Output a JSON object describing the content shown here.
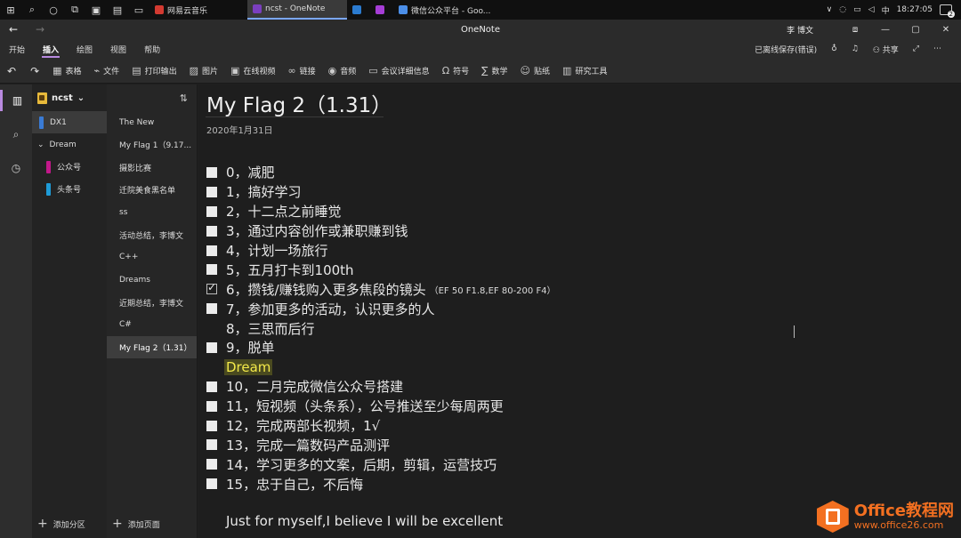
{
  "taskbar": {
    "apps": [
      {
        "label": "网易云音乐",
        "color": "#d33a31",
        "active": false
      },
      {
        "label": "ncst - OneNote",
        "color": "#7b3fbf",
        "active": true
      },
      {
        "label": "",
        "color": "#2b7bd0",
        "active": false
      },
      {
        "label": "",
        "color": "#a63dd6",
        "active": false
      },
      {
        "label": "微信公众平台 - Goo...",
        "color": "#4b8ee8",
        "active": false
      }
    ],
    "tray": {
      "ime": "中",
      "time": "18:27:05",
      "notifications": "2"
    }
  },
  "titlebar": {
    "title": "OneNote",
    "user": "李 博文"
  },
  "ribbon": {
    "tabs": [
      "开始",
      "插入",
      "绘图",
      "视图",
      "帮助"
    ],
    "active_tab": "插入",
    "save_status": "已离线保存(错误)",
    "share": "共享"
  },
  "toolbar": {
    "items": [
      {
        "label": "表格",
        "icon": "table-icon",
        "glyph": "▦"
      },
      {
        "label": "文件",
        "icon": "attach-icon",
        "glyph": "⌁"
      },
      {
        "label": "打印输出",
        "icon": "printout-icon",
        "glyph": "▤"
      },
      {
        "label": "图片",
        "icon": "picture-icon",
        "glyph": "▨"
      },
      {
        "label": "在线视频",
        "icon": "video-icon",
        "glyph": "▣"
      },
      {
        "label": "链接",
        "icon": "link-icon",
        "glyph": "∞"
      },
      {
        "label": "音频",
        "icon": "audio-icon",
        "glyph": "◉"
      },
      {
        "label": "会议详细信息",
        "icon": "meeting-icon",
        "glyph": "▭"
      },
      {
        "label": "符号",
        "icon": "omega-icon",
        "glyph": "Ω"
      },
      {
        "label": "数学",
        "icon": "math-icon",
        "glyph": "∑"
      },
      {
        "label": "贴纸",
        "icon": "sticker-icon",
        "glyph": "☺"
      },
      {
        "label": "研究工具",
        "icon": "research-icon",
        "glyph": "▥"
      }
    ]
  },
  "sections": {
    "notebook": "ncst",
    "items": [
      {
        "label": "DX1",
        "color": "#3a7bd5",
        "kind": "section",
        "selected": true
      },
      {
        "label": "Dream",
        "color": "",
        "kind": "group",
        "selected": false
      },
      {
        "label": "公众号",
        "color": "#c2188a",
        "kind": "child",
        "selected": false
      },
      {
        "label": "头条号",
        "color": "#1e9bd7",
        "kind": "child",
        "selected": false
      }
    ],
    "add_label": "添加分区"
  },
  "pages": {
    "items": [
      {
        "label": "The New",
        "selected": false
      },
      {
        "label": "My Flag 1（9.17...",
        "selected": false
      },
      {
        "label": "摄影比赛",
        "selected": false
      },
      {
        "label": "迁院美食黑名单",
        "selected": false
      },
      {
        "label": "ss",
        "selected": false
      },
      {
        "label": "活动总结，李博文",
        "selected": false
      },
      {
        "label": "C++",
        "selected": false
      },
      {
        "label": "Dreams",
        "selected": false
      },
      {
        "label": "近期总结，李博文",
        "selected": false
      },
      {
        "label": "C#",
        "selected": false
      },
      {
        "label": "My Flag 2（1.31）",
        "selected": true
      }
    ],
    "add_label": "添加页面"
  },
  "note": {
    "title": "My Flag 2（1.31）",
    "date": "2020年1月31日",
    "items": [
      {
        "text": "0，减肥",
        "state": "unchecked",
        "note": ""
      },
      {
        "text": "1，搞好学习",
        "state": "unchecked",
        "note": ""
      },
      {
        "text": "2，十二点之前睡觉",
        "state": "unchecked",
        "note": ""
      },
      {
        "text": "3，通过内容创作或兼职赚到钱",
        "state": "unchecked",
        "note": ""
      },
      {
        "text": "4，计划一场旅行",
        "state": "unchecked",
        "note": ""
      },
      {
        "text": "5，五月打卡到100th",
        "state": "unchecked",
        "note": ""
      },
      {
        "text": "6，攒钱/赚钱购入更多焦段的镜头",
        "state": "checked",
        "note": "（EF 50 F1.8,EF 80-200 F4）"
      },
      {
        "text": "7，参加更多的活动，认识更多的人",
        "state": "unchecked",
        "note": ""
      },
      {
        "text": "8，三思而后行",
        "state": "none",
        "note": ""
      },
      {
        "text": "9，脱单",
        "state": "unchecked",
        "note": ""
      },
      {
        "text": "Dream",
        "state": "highlight",
        "note": ""
      },
      {
        "text": "10，二月完成微信公众号搭建",
        "state": "unchecked",
        "note": ""
      },
      {
        "text": "11，短视频（头条系），公号推送至少每周两更",
        "state": "unchecked",
        "note": ""
      },
      {
        "text": "12，完成两部长视频，1√",
        "state": "unchecked",
        "note": ""
      },
      {
        "text": "13，完成一篇数码产品测评",
        "state": "unchecked",
        "note": ""
      },
      {
        "text": "14，学习更多的文案，后期，剪辑，运营技巧",
        "state": "unchecked",
        "note": ""
      },
      {
        "text": "15，忠于自己，不后悔",
        "state": "unchecked",
        "note": ""
      }
    ],
    "footer": "Just for myself,I believe I will be excellent"
  },
  "watermark": {
    "title": "Office教程网",
    "url": "www.office26.com"
  },
  "colors": {
    "accent": "#b98ae0",
    "watermark": "#f37021",
    "highlight": "#f3e94a"
  }
}
